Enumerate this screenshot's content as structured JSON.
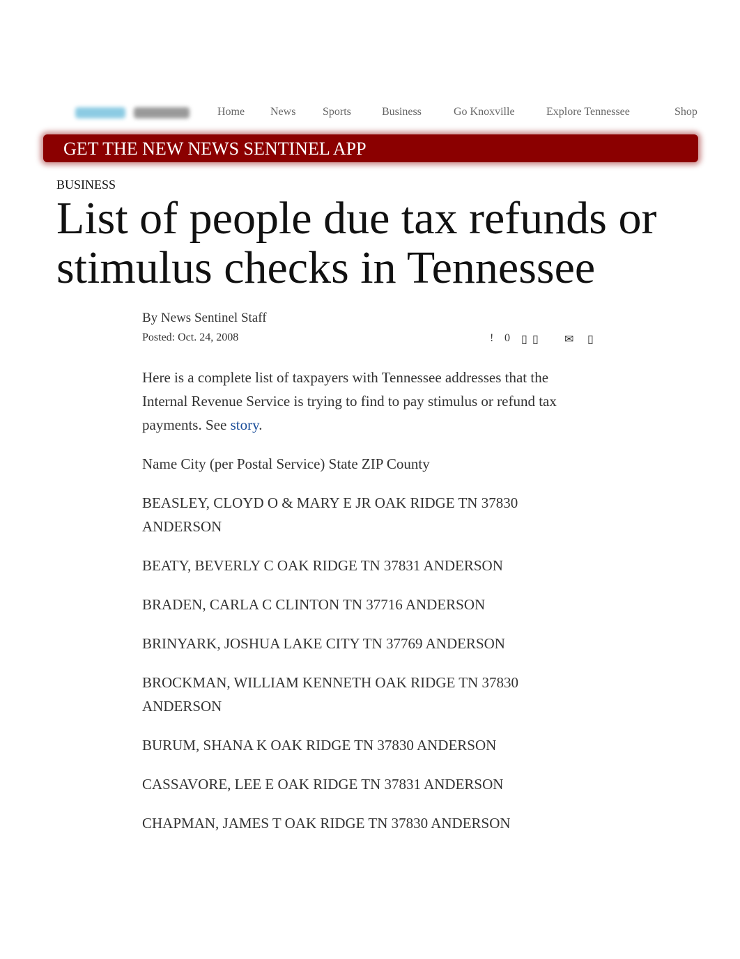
{
  "nav": [
    "Home",
    "News",
    "Sports",
    "Business",
    "Go Knoxville",
    "Explore Tennessee",
    "Shop"
  ],
  "banner": "GET THE NEW NEWS SENTINEL APP",
  "section": "BUSINESS",
  "title": "List of people due tax refunds or stimulus checks in Tennessee",
  "byline": "By News Sentinel Staff",
  "posted_label": "Posted:",
  "posted_date": "Oct. 24, 2008",
  "share": {
    "comments_icon": "!",
    "comment_count": "0",
    "icon_a": "▯",
    "icon_b": "▯",
    "email_icon": "✉",
    "icon_c": "▯"
  },
  "intro": "Here is a complete list of taxpayers with Tennessee addresses that the Internal Revenue Service is trying to find to pay stimulus or refund tax payments. See ",
  "story_link": "story",
  "intro_end": ".",
  "header_row": "Name City (per Postal Service) State ZIP County",
  "entries": [
    "BEASLEY, CLOYD O & MARY E JR OAK RIDGE TN 37830 ANDERSON",
    "BEATY, BEVERLY C OAK RIDGE TN 37831 ANDERSON",
    "BRADEN, CARLA C CLINTON TN 37716 ANDERSON",
    "BRINYARK, JOSHUA LAKE CITY TN 37769 ANDERSON",
    "BROCKMAN, WILLIAM KENNETH OAK RIDGE TN 37830 ANDERSON",
    "BURUM, SHANA K OAK RIDGE TN 37830 ANDERSON",
    "CASSAVORE, LEE E OAK RIDGE TN 37831 ANDERSON",
    "CHAPMAN, JAMES T OAK RIDGE TN 37830 ANDERSON"
  ]
}
